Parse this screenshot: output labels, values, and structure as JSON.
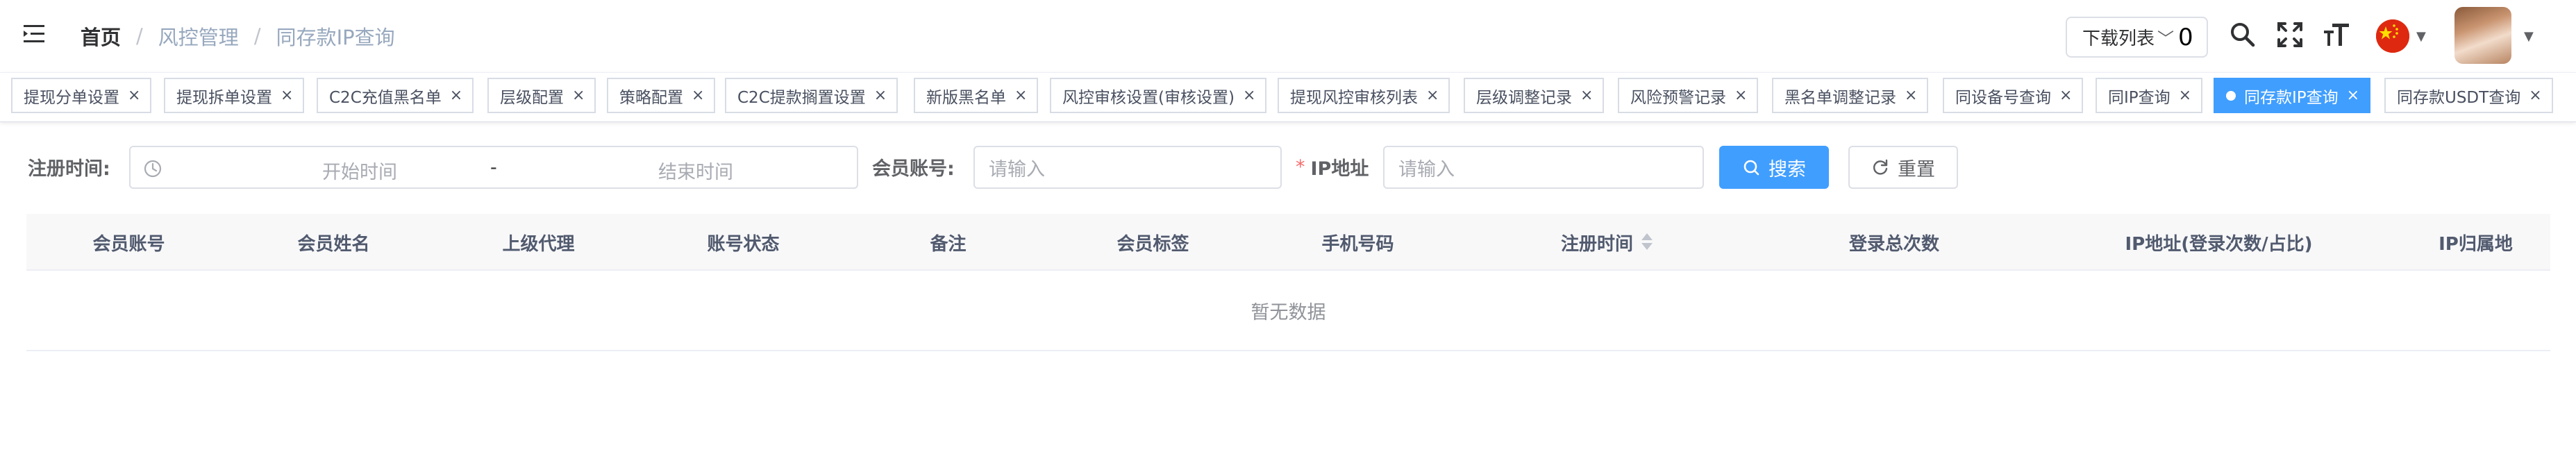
{
  "breadcrumb": {
    "home": "首页",
    "section": "风控管理",
    "current": "同存款IP查询",
    "separator": "/"
  },
  "header": {
    "download_label": "下载列表",
    "download_count": "0",
    "icons": [
      "search-icon",
      "fullscreen-icon",
      "font-size-icon",
      "china-flag-icon",
      "avatar"
    ]
  },
  "tags": [
    "提现分单设置",
    "提现拆单设置",
    "C2C充值黑名单",
    "层级配置",
    "策略配置",
    "C2C提款搁置设置",
    "新版黑名单",
    "风控审核设置(审核设置)",
    "提现风控审核列表",
    "层级调整记录",
    "风险预警记录",
    "黑名单调整记录",
    "同设备号查询",
    "同IP查询",
    "同存款IP查询",
    "同存款USDT查询"
  ],
  "active_tag_index": 14,
  "form": {
    "register_time_label": "注册时间:",
    "start_placeholder": "开始时间",
    "range_separator": "-",
    "end_placeholder": "结束时间",
    "member_account_label": "会员账号:",
    "member_account_placeholder": "请输入",
    "ip_required_mark": "*",
    "ip_label": "IP地址",
    "ip_placeholder": "请输入",
    "search_button": "搜索",
    "reset_button": "重置"
  },
  "table": {
    "columns": [
      "会员账号",
      "会员姓名",
      "上级代理",
      "账号状态",
      "备注",
      "会员标签",
      "手机号码",
      "注册时间",
      "登录总次数",
      "IP地址(登录次数/占比)",
      "IP归属地"
    ],
    "sortable_column_index": 7,
    "empty_text": "暂无数据"
  },
  "colors": {
    "primary": "#409eff",
    "required": "#f56c6c",
    "header_bg": "#f8f8f9",
    "flag_red": "#de2910",
    "flag_yellow": "#ffde00"
  }
}
